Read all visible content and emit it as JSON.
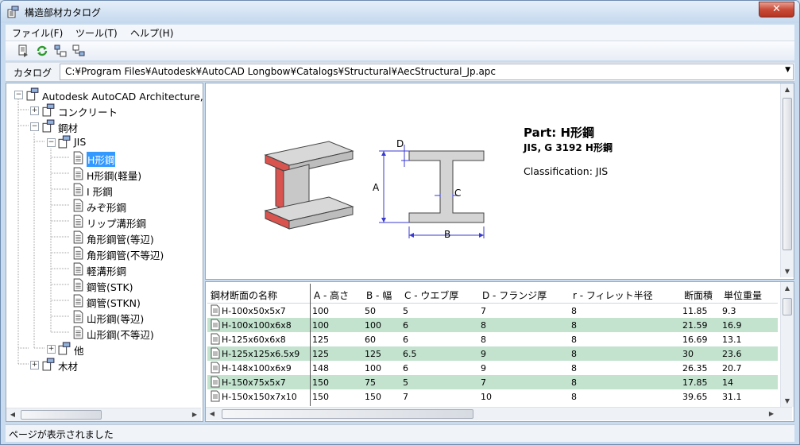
{
  "window": {
    "title": "構造部材カタログ",
    "close_label": "✕"
  },
  "menu": [
    {
      "label": "ファイル(F)"
    },
    {
      "label": "ツール(T)"
    },
    {
      "label": "ヘルプ(H)"
    }
  ],
  "toolbar": {
    "icons": [
      "back-icon",
      "refresh-icon",
      "tree-expand-icon",
      "tree-collapse-icon"
    ]
  },
  "catalog": {
    "label": "カタログ",
    "path": "C:¥Program Files¥Autodesk¥AutoCAD Longbow¥Catalogs¥Structural¥AecStructural_Jp.apc"
  },
  "tree": {
    "root": "Autodesk AutoCAD Architecture, 材",
    "concrete": "コンクリート",
    "steel": "鋼材",
    "jis": "JIS",
    "shapes": [
      "H形鋼",
      "H形鋼(軽量)",
      "I 形鋼",
      "みぞ形鋼",
      "リップ溝形鋼",
      "角形鋼管(等辺)",
      "角形鋼管(不等辺)",
      "軽溝形鋼",
      "鋼管(STK)",
      "鋼管(STKN)",
      "山形鋼(等辺)",
      "山形鋼(不等辺)"
    ],
    "other": "他",
    "wood": "木材",
    "selected_index": 0
  },
  "preview": {
    "part_title": "Part: H形鋼",
    "part_subtitle": "JIS, G 3192 H形鋼",
    "classification": "Classification:  JIS",
    "dim_labels": {
      "d": "D",
      "a": "A",
      "c": "C",
      "b": "B"
    }
  },
  "grid": {
    "columns": [
      "鋼材断面の名称",
      "A - 高さ",
      "B - 幅",
      "C - ウエブ厚",
      "D - フランジ厚",
      "r - フィレット半径",
      "断面積",
      "単位重量"
    ],
    "rows": [
      [
        "H-100x50x5x7",
        "100",
        "50",
        "5",
        "7",
        "8",
        "11.85",
        "9.3"
      ],
      [
        "H-100x100x6x8",
        "100",
        "100",
        "6",
        "8",
        "8",
        "21.59",
        "16.9"
      ],
      [
        "H-125x60x6x8",
        "125",
        "60",
        "6",
        "8",
        "8",
        "16.69",
        "13.1"
      ],
      [
        "H-125x125x6.5x9",
        "125",
        "125",
        "6.5",
        "9",
        "8",
        "30",
        "23.6"
      ],
      [
        "H-148x100x6x9",
        "148",
        "100",
        "6",
        "9",
        "8",
        "26.35",
        "20.7"
      ],
      [
        "H-150x75x5x7",
        "150",
        "75",
        "5",
        "7",
        "8",
        "17.85",
        "14"
      ],
      [
        "H-150x150x7x10",
        "150",
        "150",
        "7",
        "10",
        "8",
        "39.65",
        "31.1"
      ]
    ]
  },
  "status": {
    "text": "ページが表示されました"
  },
  "colors": {
    "selection": "#3399ff",
    "alt_row": "#c3e3cf",
    "dimension": "#3a3ad0",
    "flange_cut": "#d9534f"
  }
}
